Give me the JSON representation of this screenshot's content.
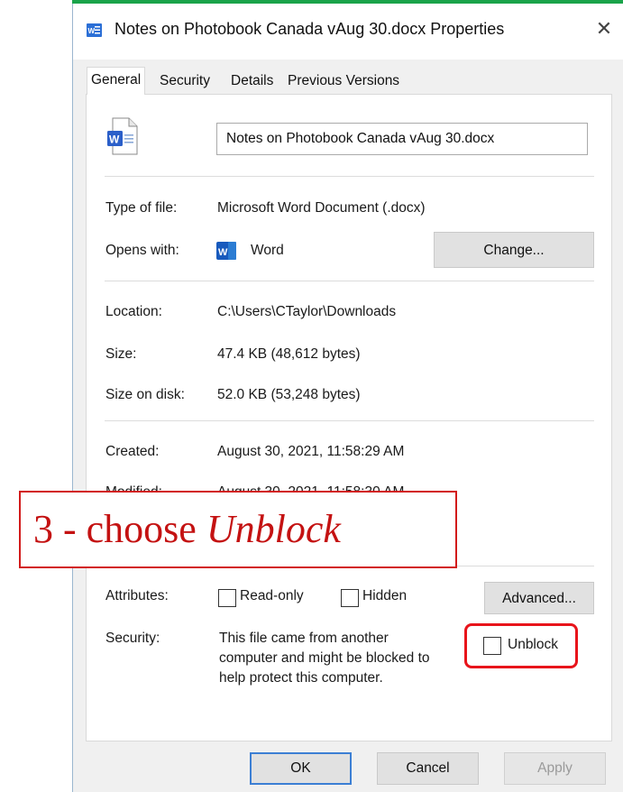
{
  "window": {
    "title": "Notes on Photobook Canada vAug 30.docx Properties",
    "close_glyph": "✕",
    "accent_color": "#1aa34a"
  },
  "tabs": [
    {
      "label": "General",
      "active": true
    },
    {
      "label": "Security",
      "active": false
    },
    {
      "label": "Details",
      "active": false
    },
    {
      "label": "Previous Versions",
      "active": false
    }
  ],
  "general": {
    "file_name": "Notes on Photobook Canada vAug 30.docx",
    "type_label": "Type of file:",
    "type_value": "Microsoft Word Document (.docx)",
    "opens_label": "Opens with:",
    "opens_value": "Word",
    "change_button": "Change...",
    "location_label": "Location:",
    "location_value": "C:\\Users\\CTaylor\\Downloads",
    "size_label": "Size:",
    "size_value": "47.4 KB (48,612 bytes)",
    "size_on_disk_label": "Size on disk:",
    "size_on_disk_value": "52.0 KB (53,248 bytes)",
    "created_label": "Created:",
    "created_value": "August 30, 2021, 11:58:29 AM",
    "modified_label": "Modified:",
    "modified_value": "August 30, 2021, 11:58:30 AM",
    "attributes_label": "Attributes:",
    "readonly_label": "Read-only",
    "hidden_label": "Hidden",
    "advanced_button": "Advanced...",
    "security_label": "Security:",
    "security_line1": "This file came from another",
    "security_line2": "computer and might be blocked to",
    "security_line3": "help protect this computer.",
    "unblock_label": "Unblock"
  },
  "footer": {
    "ok": "OK",
    "cancel": "Cancel",
    "apply": "Apply"
  },
  "annotation": {
    "prefix": "3 - choose ",
    "emphasis": "Unblock",
    "color": "#d21b1b"
  }
}
